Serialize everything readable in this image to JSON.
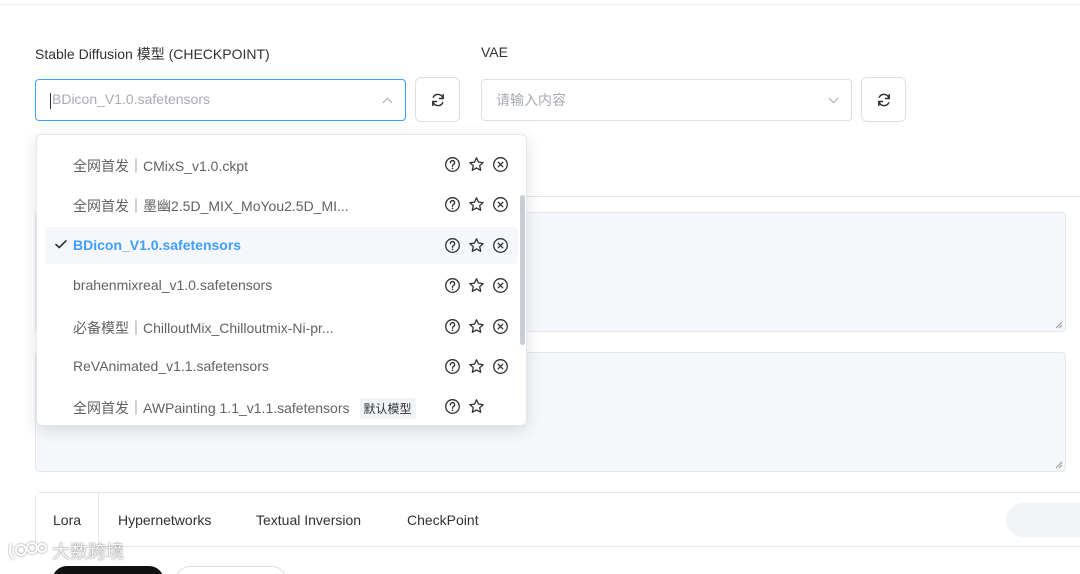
{
  "model": {
    "label": "Stable Diffusion 模型 (CHECKPOINT)",
    "input_value": "BDicon_V1.0.safetensors"
  },
  "vae": {
    "label": "VAE",
    "placeholder": "请输入内容"
  },
  "dropdown": {
    "items": [
      {
        "label": "全网首发｜CMixS_v1.0.ckpt",
        "selected": false,
        "tag": ""
      },
      {
        "label": "全网首发｜墨幽2.5D_MIX_MoYou2.5D_MI...",
        "selected": false,
        "tag": ""
      },
      {
        "label": "BDicon_V1.0.safetensors",
        "selected": true,
        "tag": ""
      },
      {
        "label": "brahenmixreal_v1.0.safetensors",
        "selected": false,
        "tag": ""
      },
      {
        "label": "必备模型｜ChilloutMix_Chilloutmix-Ni-pr...",
        "selected": false,
        "tag": ""
      },
      {
        "label": "ReVAnimated_v1.1.safetensors",
        "selected": false,
        "tag": ""
      },
      {
        "label": "全网首发｜AWPainting 1.1_v1.1.safetensors",
        "selected": false,
        "tag": "默认模型"
      }
    ]
  },
  "tabs": [
    {
      "label": "Lora"
    },
    {
      "label": "Hypernetworks"
    },
    {
      "label": "Textual Inversion"
    },
    {
      "label": "CheckPoint"
    }
  ],
  "watermark": "大数跨境",
  "colors": {
    "accent": "#409eff",
    "border": "#dcdfe6",
    "textarea_bg": "#f5f7fa"
  }
}
